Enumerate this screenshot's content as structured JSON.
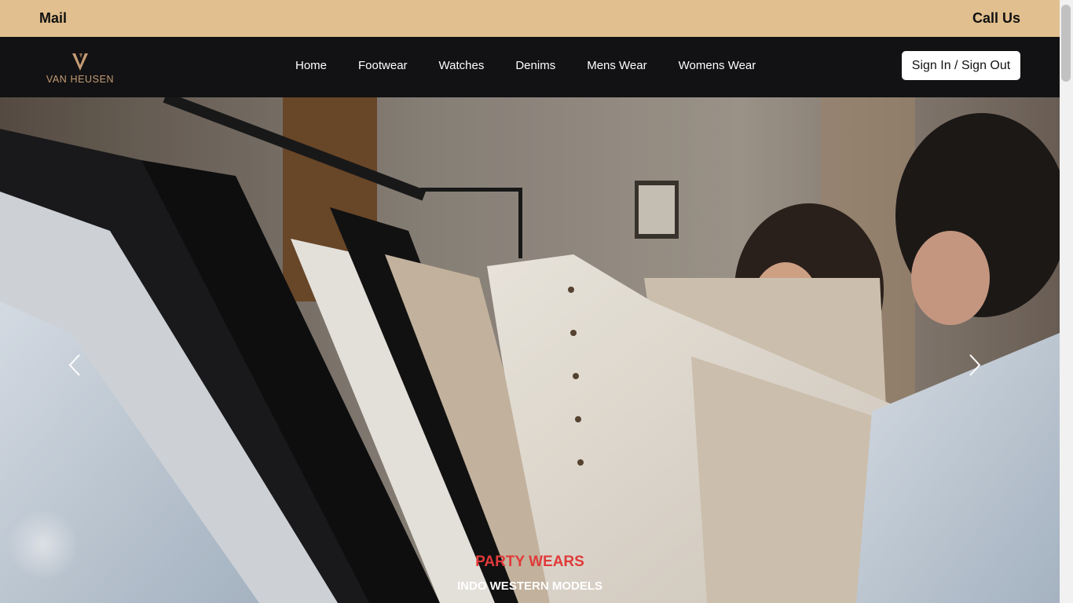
{
  "topbar": {
    "mail_label": "Mail",
    "call_label": "Call Us",
    "bg_color": "#e1bf8e"
  },
  "navbar": {
    "brand_mark": "V",
    "brand_name": "VAN HEUSEN",
    "links": [
      "Home",
      "Footwear",
      "Watches",
      "Denims",
      "Mens Wear",
      "Womens Wear"
    ],
    "signin_label": "Sign In / Sign Out",
    "bg_color": "#121214"
  },
  "carousel": {
    "prev_icon": "chevron-left-icon",
    "next_icon": "chevron-right-icon",
    "slide_title": "PARTY WEARS",
    "slide_subtitle": "INDO WESTERN MODELS",
    "title_color": "#e03a3a"
  }
}
